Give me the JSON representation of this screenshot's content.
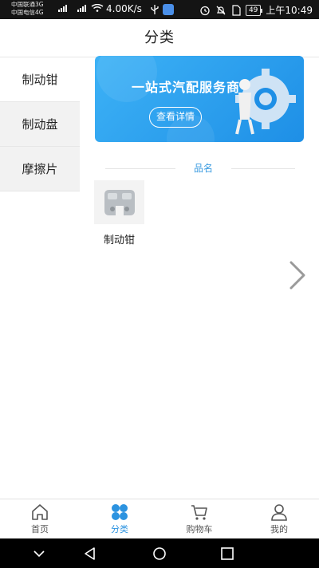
{
  "status_bar": {
    "carrier1": "中国联通3G",
    "carrier2": "中国电信4G",
    "speed": "4.00K/s",
    "battery": "49",
    "time": "上午10:49"
  },
  "header": {
    "title": "分类"
  },
  "sidebar": {
    "items": [
      {
        "label": "制动钳",
        "active": true
      },
      {
        "label": "制动盘",
        "active": false
      },
      {
        "label": "摩擦片",
        "active": false
      }
    ]
  },
  "banner": {
    "title": "一站式汽配服务商",
    "button": "查看详情"
  },
  "section": {
    "label": "品名"
  },
  "products": [
    {
      "name": "制动钳"
    }
  ],
  "bottom_nav": {
    "items": [
      {
        "label": "首页",
        "icon": "home-icon",
        "active": false
      },
      {
        "label": "分类",
        "icon": "category-icon",
        "active": true
      },
      {
        "label": "购物车",
        "icon": "cart-icon",
        "active": false
      },
      {
        "label": "我的",
        "icon": "user-icon",
        "active": false
      }
    ]
  },
  "colors": {
    "accent": "#2c93e0",
    "banner": "#2a9ef0",
    "sidebar_bg": "#f2f2f2"
  }
}
